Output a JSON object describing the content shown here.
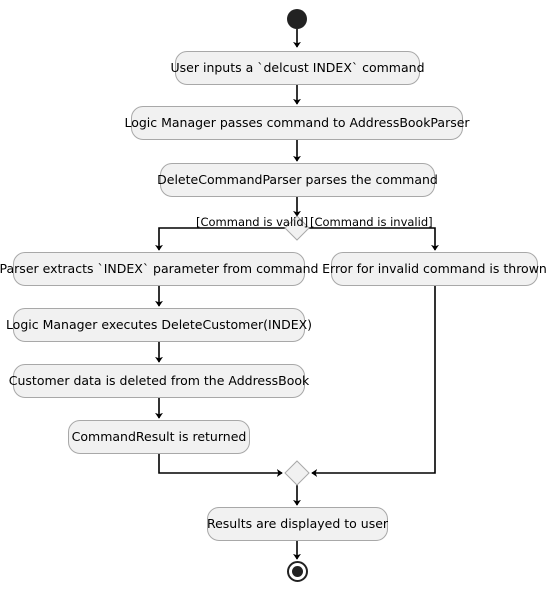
{
  "diagram": {
    "type": "uml-activity-diagram",
    "title": "",
    "colors": {
      "node_fill": "#F1F1F1",
      "node_border": "#A8A8A8",
      "edge": "#000000",
      "terminal": "#222222",
      "background": "#FFFFFF"
    },
    "start_node": {
      "name": "start",
      "shape": "filled-circle"
    },
    "end_node": {
      "name": "end",
      "shape": "circle-with-filled-center"
    },
    "nodes": [
      {
        "id": "n1",
        "label": "User inputs a `delcust INDEX` command"
      },
      {
        "id": "n2",
        "label": "Logic Manager passes command to AddressBookParser"
      },
      {
        "id": "n3",
        "label": "DeleteCommandParser parses the command"
      },
      {
        "id": "n4",
        "label": "Parser extracts `INDEX` parameter from command"
      },
      {
        "id": "n5",
        "label": "Error for invalid command is thrown"
      },
      {
        "id": "n6",
        "label": "Logic Manager executes DeleteCustomer(INDEX)"
      },
      {
        "id": "n7",
        "label": "Customer data is deleted from the AddressBook"
      },
      {
        "id": "n8",
        "label": "CommandResult is returned"
      },
      {
        "id": "n9",
        "label": "Results are displayed to user"
      }
    ],
    "decision": {
      "name": "decision-diamond",
      "branch_true_label": "[Command is valid]",
      "branch_false_label": "[Command is invalid]"
    },
    "merge": {
      "name": "merge-diamond"
    }
  }
}
